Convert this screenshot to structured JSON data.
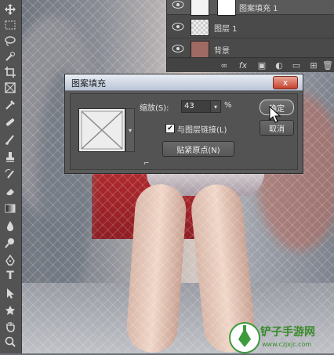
{
  "layers_panel": {
    "layers": [
      {
        "name": "图案填充 1"
      },
      {
        "name": "图层 1"
      },
      {
        "name": "背景"
      }
    ],
    "bottom_icons": [
      "link-icon",
      "fx-icon",
      "mask-icon",
      "adjustment-icon",
      "folder-icon",
      "new-layer-icon",
      "trash-icon"
    ]
  },
  "dialog": {
    "title": "图案填充",
    "close_label": "x",
    "scale_label": "缩放(S):",
    "scale_value": "43",
    "scale_unit": "%",
    "link_label": "与图层链接(L)",
    "link_checked": true,
    "snap_label": "贴紧原点(N)",
    "ok_label": "确定",
    "cancel_label": "取消"
  },
  "watermark": {
    "title": "铲子手游网",
    "url": "www.czjxjc.com"
  },
  "toolbar": {
    "tools": [
      "move-tool",
      "marquee-tool",
      "lasso-tool",
      "quick-select-tool",
      "crop-tool",
      "frame-tool",
      "eyedropper-tool",
      "healing-tool",
      "brush-tool",
      "clone-stamp-tool",
      "history-brush-tool",
      "eraser-tool",
      "gradient-tool",
      "blur-tool",
      "dodge-tool",
      "pen-tool",
      "type-tool",
      "path-select-tool",
      "shape-tool",
      "hand-tool",
      "zoom-tool"
    ]
  },
  "colors": {
    "panel": "#535353",
    "dialog_title": "#c9d2e1",
    "close_button": "#c6412c",
    "watermark_green": "#3a8a2a"
  }
}
